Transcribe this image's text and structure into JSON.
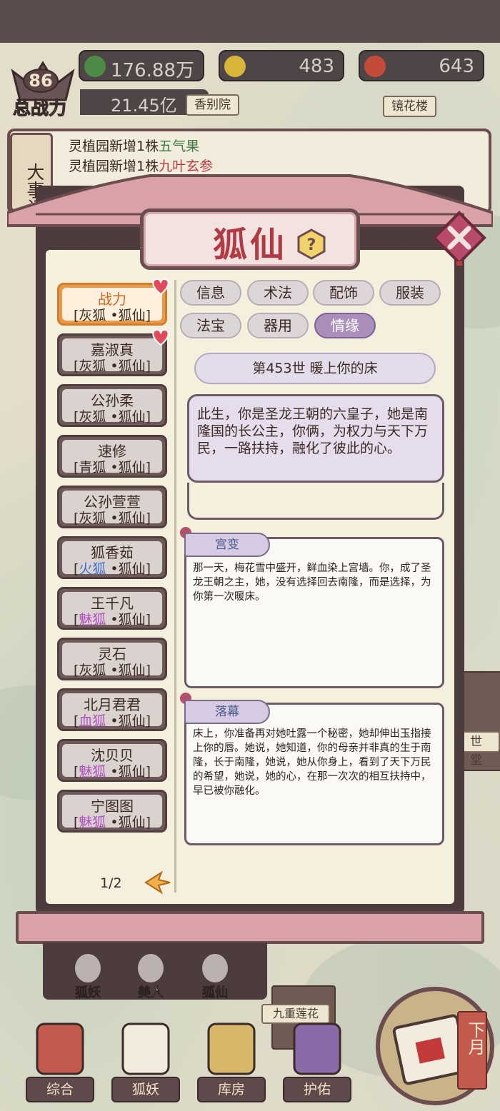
{
  "resources": {
    "leaf": "176.88万",
    "gold": "483",
    "gem": "643"
  },
  "power": {
    "level": "86",
    "label": "总战力",
    "value": "21.45亿"
  },
  "map_places": {
    "left": "香别院",
    "right": "镜花楼",
    "side": "世堂",
    "lotus": "九重莲花"
  },
  "event_log": {
    "tab_label": "大事记",
    "line1_prefix": "灵植园新增1株",
    "line1_item": "五气果",
    "line2_prefix": "灵植园新增1株",
    "line2_item": "九叶玄参"
  },
  "dialog": {
    "title": "狐仙",
    "help_symbol": "?",
    "page_indicator": "1/2"
  },
  "characters": [
    {
      "name": "战力",
      "type": "灰狐",
      "suffix": "•狐仙]",
      "type_color": "#3d2a25",
      "selected": true,
      "heart": true
    },
    {
      "name": "嘉淑真",
      "type": "灰狐",
      "suffix": "•狐仙]",
      "type_color": "#3d2a25",
      "selected": false,
      "heart": true
    },
    {
      "name": "公孙柔",
      "type": "灰狐",
      "suffix": "•狐仙]",
      "type_color": "#3d2a25",
      "selected": false,
      "heart": false
    },
    {
      "name": "速修",
      "type": "青狐",
      "suffix": "•狐仙]",
      "type_color": "#3d2a25",
      "selected": false,
      "heart": false
    },
    {
      "name": "公孙萱萱",
      "type": "灰狐",
      "suffix": "•狐仙]",
      "type_color": "#3d2a25",
      "selected": false,
      "heart": false
    },
    {
      "name": "狐香茹",
      "type": "火狐",
      "suffix": "•狐仙]",
      "type_color": "#3d6fd0",
      "selected": false,
      "heart": false
    },
    {
      "name": "王千凡",
      "type": "魅狐",
      "suffix": "•狐仙]",
      "type_color": "#b04fc0",
      "selected": false,
      "heart": false
    },
    {
      "name": "灵石",
      "type": "灰狐",
      "suffix": "•狐仙]",
      "type_color": "#3d2a25",
      "selected": false,
      "heart": false
    },
    {
      "name": "北月君君",
      "type": "血狐",
      "suffix": "•狐仙]",
      "type_color": "#b04fc0",
      "selected": false,
      "heart": false
    },
    {
      "name": "沈贝贝",
      "type": "魅狐",
      "suffix": "•狐仙]",
      "type_color": "#b04fc0",
      "selected": false,
      "heart": false
    },
    {
      "name": "宁图图",
      "type": "魅狐",
      "suffix": "•狐仙]",
      "type_color": "#b04fc0",
      "selected": false,
      "heart": false
    }
  ],
  "tabs": [
    {
      "label": "信息",
      "active": false
    },
    {
      "label": "术法",
      "active": false
    },
    {
      "label": "配饰",
      "active": false
    },
    {
      "label": "服装",
      "active": false
    },
    {
      "label": "法宝",
      "active": false
    },
    {
      "label": "器用",
      "active": false
    },
    {
      "label": "情缘",
      "active": true
    }
  ],
  "story": {
    "generation_title": "第453世  暖上你的床",
    "summary": "此生，你是圣龙王朝的六皇子，她是南隆国的长公主，你俩，为权力与天下万民，一路扶持，融化了彼此的心。",
    "chapters": [
      {
        "label": "宫变",
        "text": "那一天，梅花雪中盛开，鲜血染上宫墙。你，成了圣龙王朝之主，她，没有选择回去南隆，而是选择，为你第一次暖床。"
      },
      {
        "label": "落幕",
        "text": "床上，你准备再对她吐露一个秘密，她却伸出玉指接上你的唇。她说，她知道，你的母亲并非真的生于南隆，长于南隆，她说，她从你身上，看到了天下万民的希望，她说，她的心，在那一次次的相互扶持中，早已被你融化。"
      }
    ]
  },
  "categories": [
    {
      "label": "狐妖",
      "icon": "fox-icon"
    },
    {
      "label": "美人",
      "icon": "beauty-icon"
    },
    {
      "label": "狐仙",
      "icon": "fox-immortal-icon"
    }
  ],
  "bottom_nav": [
    {
      "label": "综合",
      "icon": "gate-icon"
    },
    {
      "label": "狐妖",
      "icon": "fox-mask-icon"
    },
    {
      "label": "库房",
      "icon": "storehouse-icon"
    },
    {
      "label": "护佑",
      "icon": "lotus-icon"
    }
  ],
  "next_month": "下月",
  "colors": {
    "accent_red": "#b23a45",
    "frame": "#4d3c3d",
    "tab_active": "#a98fb9",
    "selected_orange": "#e79a4a"
  }
}
